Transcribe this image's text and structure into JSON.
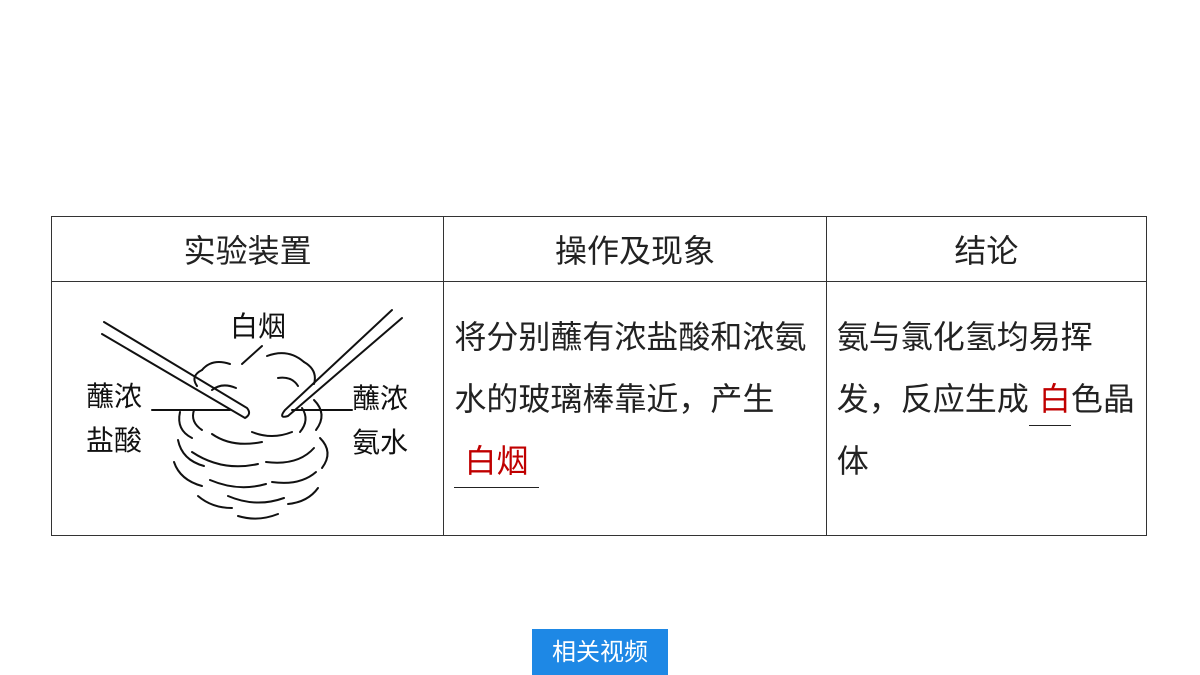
{
  "table": {
    "headers": [
      "实验装置",
      "操作及现象",
      "结论"
    ],
    "diagram_labels": {
      "smoke": "白烟",
      "left_line1": "蘸浓",
      "left_line2": "盐酸",
      "right_line1": "蘸浓",
      "right_line2": "氨水"
    },
    "operation": {
      "text": "将分别蘸有浓盐酸和浓氨水的玻璃棒靠近，产生",
      "answer": "白烟"
    },
    "conclusion": {
      "before": "氨与氯化氢均易挥发，反应生成",
      "answer": "白",
      "after": "色晶体"
    }
  },
  "video_button": {
    "label": "相关视频"
  },
  "colors": {
    "answer": "#c00000",
    "button_bg": "#1e88e5"
  }
}
